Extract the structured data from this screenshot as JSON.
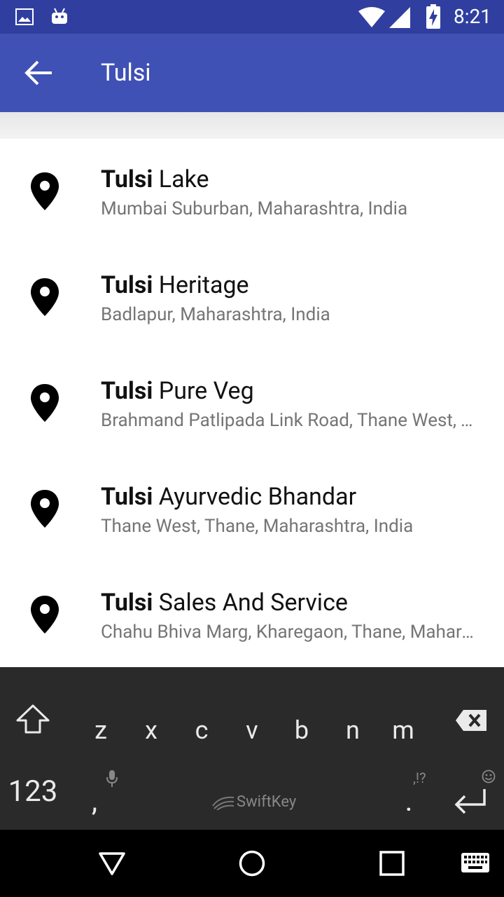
{
  "status_bar": {
    "time": "8:21",
    "icons": [
      "image-icon",
      "android-icon",
      "wifi-icon",
      "signal-icon",
      "battery-charging-icon"
    ]
  },
  "app_bar": {
    "title": "Tulsi",
    "back_icon": "arrow-back-icon"
  },
  "results": [
    {
      "match": "Tulsi",
      "rest": " Lake",
      "address": "Mumbai Suburban, Maharashtra, India"
    },
    {
      "match": "Tulsi",
      "rest": " Heritage",
      "address": "Badlapur, Maharashtra, India"
    },
    {
      "match": "Tulsi",
      "rest": " Pure Veg",
      "address": "Brahmand Patlipada Link Road, Thane West, Thane, Maharashtra, India"
    },
    {
      "match": "Tulsi",
      "rest": " Ayurvedic Bhandar",
      "address": "Thane West, Thane, Maharashtra, India"
    },
    {
      "match": "Tulsi",
      "rest": " Sales And Service",
      "address": "Chahu Bhiva Marg, Kharegaon, Thane, Maharashtra, India"
    }
  ],
  "keyboard": {
    "letters": [
      "z",
      "x",
      "c",
      "v",
      "b",
      "n",
      "m"
    ],
    "numbers_key": "123",
    "comma_key": ",",
    "period_key": ".",
    "punct_hint": ",!?",
    "brand": "SwiftKey"
  },
  "nav_bar": {
    "icons": [
      "back-triangle-icon",
      "home-circle-icon",
      "recents-square-icon",
      "keyboard-icon"
    ]
  }
}
